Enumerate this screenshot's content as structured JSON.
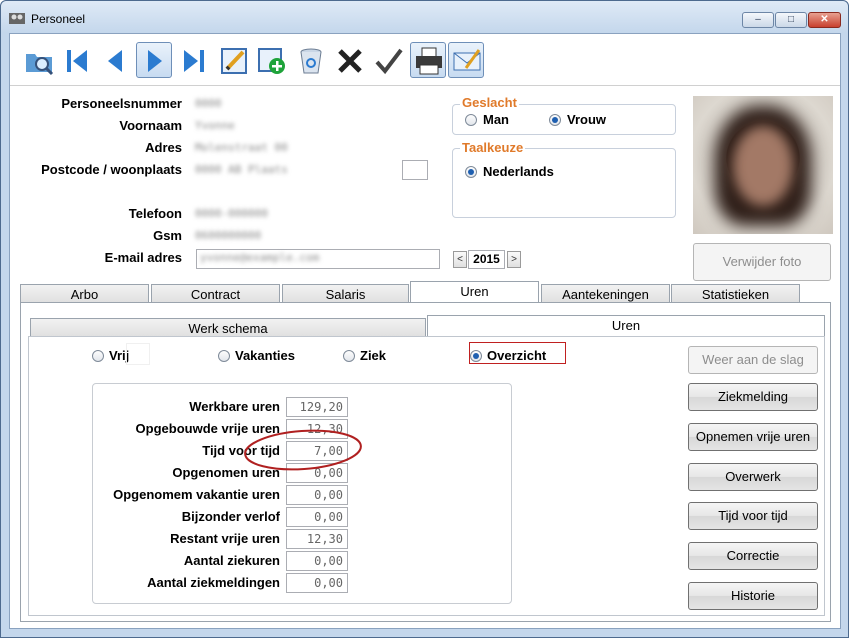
{
  "window": {
    "title": "Personeel",
    "min": "–",
    "max": "□",
    "close": "✕"
  },
  "toolbar": [
    "search-folder-icon",
    "first-record-icon",
    "previous-record-icon",
    "next-record-icon",
    "last-record-icon",
    "edit-icon",
    "add-record-icon",
    "recycle-bin-icon",
    "delete-icon",
    "confirm-check-icon",
    "print-icon",
    "email-icon"
  ],
  "person": {
    "labels": {
      "nummer": "Personeelsnummer",
      "voornaam": "Voornaam",
      "adres": "Adres",
      "postcode": "Postcode / woonplaats",
      "telefoon": "Telefoon",
      "gsm": "Gsm",
      "email": "E-mail adres"
    },
    "values": {
      "nummer": "0000",
      "voornaam": "Yvonne",
      "adres": "Molenstraat 00",
      "postcode": "0000 AB  Plaats",
      "telefoon": "0000-000000",
      "gsm": "0600000000",
      "email": "yvonne@example.com"
    }
  },
  "geslacht": {
    "title": "Geslacht",
    "options": [
      "Man",
      "Vrouw"
    ],
    "selected": "Vrouw"
  },
  "taalkeuze": {
    "title": "Taalkeuze",
    "options": [
      "Nederlands"
    ],
    "selected": "Nederlands"
  },
  "year": {
    "value": "2015",
    "prev": "<",
    "next": ">"
  },
  "photo_button": "Verwijder foto",
  "main_tabs": [
    "Arbo",
    "Contract",
    "Salaris",
    "Uren",
    "Aantekeningen",
    "Statistieken"
  ],
  "main_tab_selected": "Uren",
  "sub_tabs": [
    "Werk schema",
    "Uren"
  ],
  "sub_tab_selected": "Uren",
  "view_options": [
    "Vrij",
    "Vakanties",
    "Ziek",
    "Overzicht"
  ],
  "view_selected": "Overzicht",
  "summary": [
    {
      "label": "Werkbare uren",
      "value": "129,20"
    },
    {
      "label": "Opgebouwde vrije uren",
      "value": "12,30"
    },
    {
      "label": "Tijd voor tijd",
      "value": "7,00"
    },
    {
      "label": "Opgenomen uren",
      "value": "0,00"
    },
    {
      "label": "Opgenomem vakantie uren",
      "value": "0,00"
    },
    {
      "label": "Bijzonder verlof",
      "value": "0,00"
    },
    {
      "label": "Restant vrije uren",
      "value": "12,30"
    },
    {
      "label": "Aantal ziekuren",
      "value": "0,00"
    },
    {
      "label": "Aantal ziekmeldingen",
      "value": "0,00"
    }
  ],
  "actions": {
    "weer_aan_de_slag": "Weer aan de slag",
    "ziekmelding": "Ziekmelding",
    "opnemen": "Opnemen vrije uren",
    "overwerk": "Overwerk",
    "tijd_voor_tijd": "Tijd voor tijd",
    "correctie": "Correctie",
    "historie": "Historie"
  },
  "colors": {
    "accent_orange": "#e07a2a",
    "annotation_red": "#b02020"
  }
}
